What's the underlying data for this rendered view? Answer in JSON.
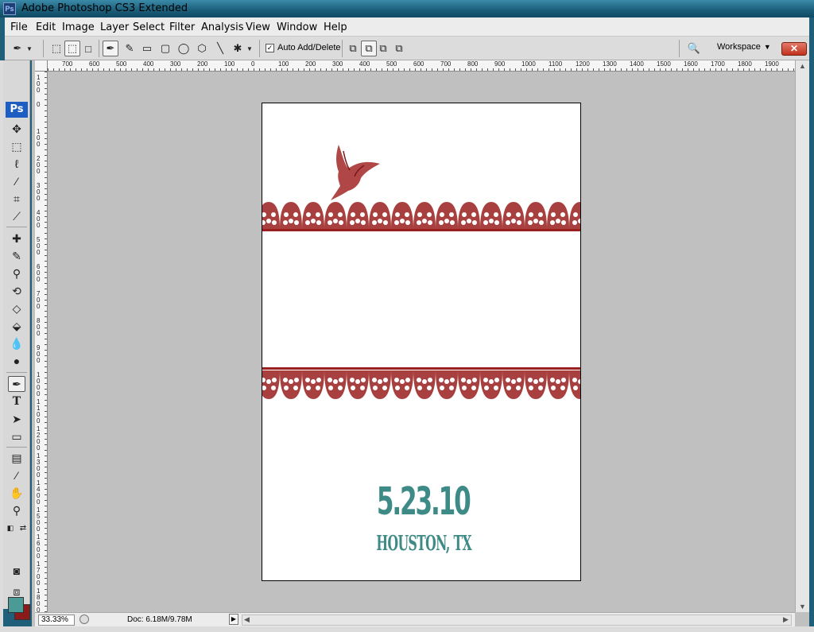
{
  "window": {
    "title": "Adobe Photoshop CS3 Extended",
    "app_icon": "Ps"
  },
  "menu": [
    "File",
    "Edit",
    "Image",
    "Layer",
    "Select",
    "Filter",
    "Analysis",
    "View",
    "Window",
    "Help"
  ],
  "options": {
    "auto_add_delete_label": "Auto Add/Delete",
    "auto_add_delete_checked": true,
    "workspace_label": "Workspace"
  },
  "toolbox": {
    "logo": "Ps",
    "foreground_color": "#4a9b96",
    "background_color": "#8b1a1a"
  },
  "rulers": {
    "h_labels": [
      "700",
      "600",
      "500",
      "400",
      "300",
      "200",
      "100",
      "0",
      "100",
      "200",
      "300",
      "400",
      "500",
      "600",
      "700",
      "800",
      "900",
      "1000",
      "1100",
      "1200",
      "1300",
      "1400",
      "1500",
      "1600",
      "1700",
      "1800",
      "1900"
    ],
    "v_labels": [
      "100",
      "0",
      "100",
      "200",
      "300",
      "400",
      "500",
      "600",
      "700",
      "800",
      "900",
      "1000",
      "1100",
      "1200",
      "1300",
      "1400",
      "1500",
      "1600",
      "1700",
      "1800"
    ]
  },
  "document": {
    "date_text": "5.23.10",
    "city_text": "HOUSTON, TX",
    "accent_color": "#3e8a86",
    "lace_color": "#9a1f1f"
  },
  "status": {
    "zoom": "33.33%",
    "doc_size": "Doc: 6.18M/9.78M"
  }
}
